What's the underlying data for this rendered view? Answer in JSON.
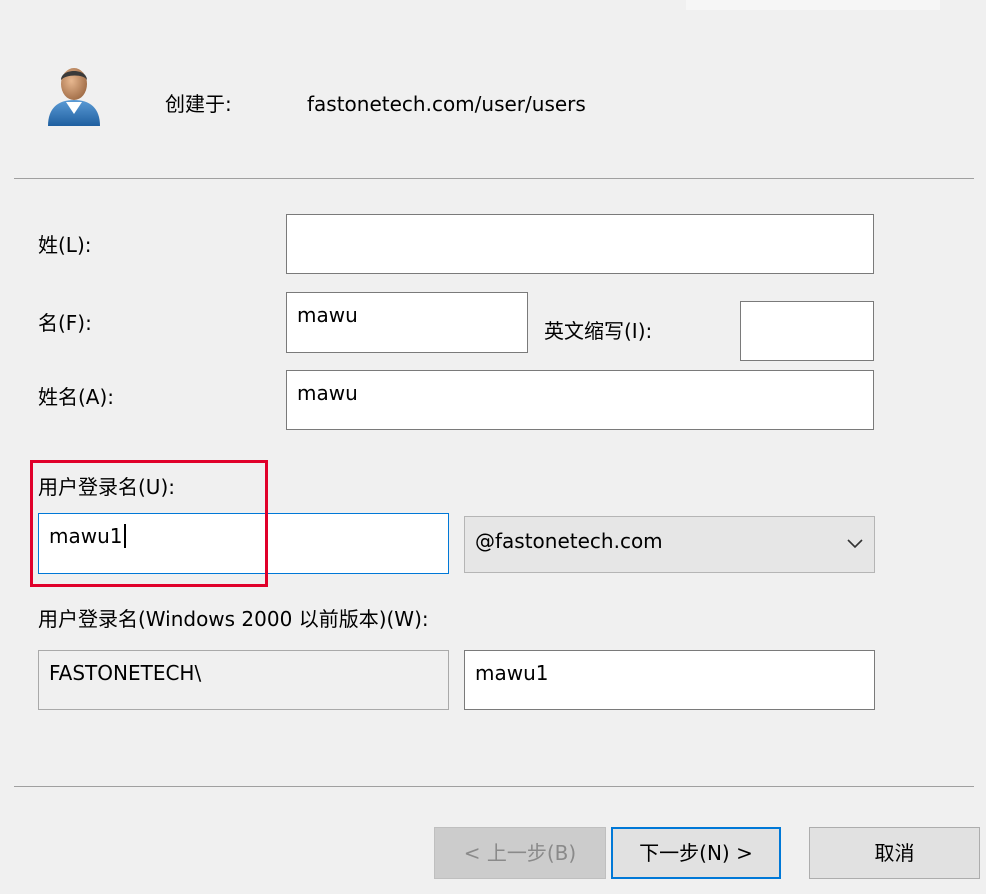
{
  "header": {
    "created_in_label": "创建于:",
    "created_in_path": "fastonetech.com/user/users"
  },
  "form": {
    "last_name": {
      "label": "姓(L):",
      "value": ""
    },
    "first_name": {
      "label": "名(F):",
      "value": "mawu"
    },
    "initials": {
      "label": "英文缩写(I):",
      "value": ""
    },
    "full_name": {
      "label": "姓名(A):",
      "value": "mawu"
    },
    "logon_name": {
      "label": "用户登录名(U):",
      "value": "mawu1"
    },
    "domain_select": {
      "selected": "@fastonetech.com"
    },
    "pre2000": {
      "label": "用户登录名(Windows 2000 以前版本)(W):",
      "domain_prefix": "FASTONETECH\\",
      "value": "mawu1"
    }
  },
  "buttons": {
    "back": "< 上一步(B)",
    "next": "下一步(N) >",
    "cancel": "取消"
  },
  "colors": {
    "background": "#f0f0f0",
    "accent_focus": "#0078d7",
    "highlight_box": "#e0002a"
  },
  "icons": {
    "avatar": "user-avatar-icon",
    "dropdown": "chevron-down-icon"
  }
}
